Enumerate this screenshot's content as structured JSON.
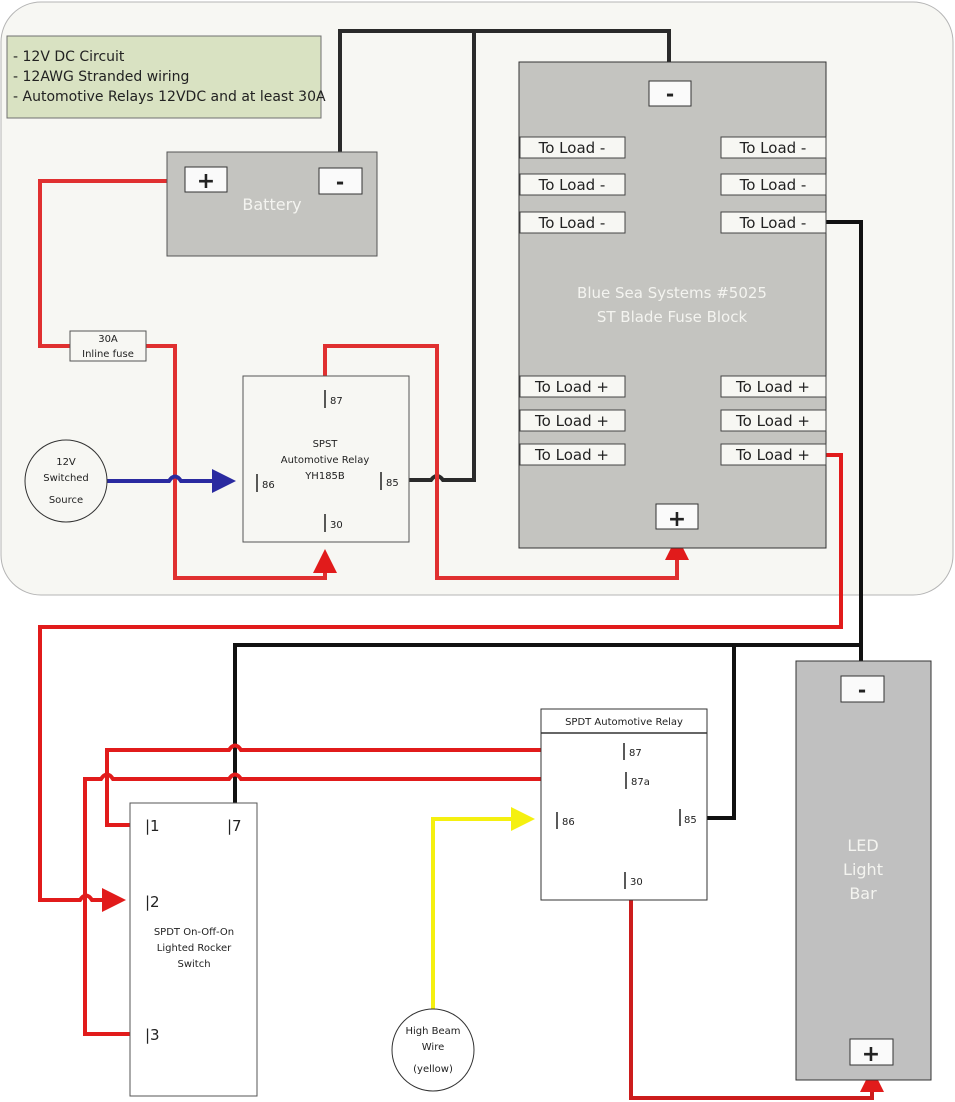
{
  "notes": {
    "lines": [
      "- 12V DC Circuit",
      "- 12AWG Stranded wiring",
      "- Automotive Relays 12VDC and at least 30A"
    ]
  },
  "colors": {
    "panel_bg": "#f7f7f3",
    "notes_bg": "#d9e2c2",
    "component_gray": "#c4c4c0",
    "light_bar_gray": "#c0c0c0",
    "wire_positive": "#e11b1b",
    "wire_negative": "#111111",
    "wire_signal_source": "#2a2aa0",
    "wire_high_beam": "#f5f010"
  },
  "battery": {
    "label": "Battery",
    "positive_terminal": "+",
    "negative_terminal": "-"
  },
  "inline_fuse": {
    "line1": "30A",
    "line2": "Inline fuse"
  },
  "switched_source": {
    "line1": "12V",
    "line2": "Switched",
    "line3": "Source"
  },
  "spst_relay": {
    "line1": "SPST",
    "line2": "Automotive Relay",
    "line3": "YH185B",
    "pins": {
      "p87": "87",
      "p86": "86",
      "p85": "85",
      "p30": "30"
    }
  },
  "fuse_block": {
    "line1": "Blue Sea Systems #5025",
    "line2": "ST Blade Fuse Block",
    "negative_terminal": "-",
    "positive_terminal": "+",
    "negative_outputs": [
      "To Load -",
      "To Load -",
      "To Load -",
      "To Load -",
      "To Load -",
      "To Load -"
    ],
    "positive_outputs": [
      "To Load +",
      "To Load +",
      "To Load +",
      "To Load +",
      "To Load +",
      "To Load +"
    ]
  },
  "rocker_switch": {
    "line1": "SPDT On-Off-On",
    "line2": "Lighted Rocker",
    "line3": "Switch",
    "pins": {
      "p1": "|1",
      "p7": "|7",
      "p2": "|2",
      "p3": "|3"
    }
  },
  "spdt_relay": {
    "title": "SPDT Automotive Relay",
    "pins": {
      "p87": "87",
      "p87a": "87a",
      "p86": "86",
      "p85": "85",
      "p30": "30"
    }
  },
  "high_beam": {
    "line1": "High Beam",
    "line2": "Wire",
    "line3": "(yellow)"
  },
  "light_bar": {
    "line1": "LED",
    "line2": "Light",
    "line3": "Bar",
    "negative_terminal": "-",
    "positive_terminal": "+"
  }
}
